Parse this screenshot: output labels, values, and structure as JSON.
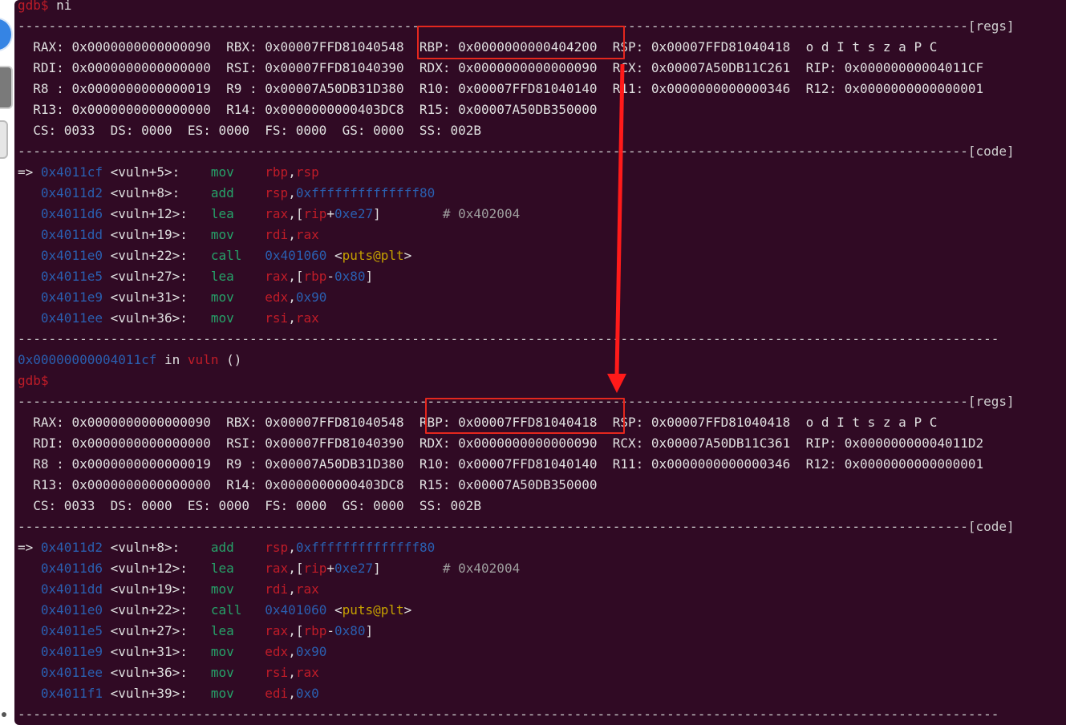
{
  "prompt": "gdb$",
  "first_command": "ni",
  "separator_regs": "---------------------------------------------------------------------------------------------------------------------------[regs]",
  "separator_code": "---------------------------------------------------------------------------------------------------------------------------[code]",
  "separator_plain": "-------------------------------------------------------------------------------------------------------------------------------",
  "flags": "o d I t s z a P C",
  "before": {
    "regs": {
      "row1": [
        {
          "name": "RAX:",
          "value": "0x0000000000000090"
        },
        {
          "name": "RBX:",
          "value": "0x00007FFD81040548"
        },
        {
          "name": "RBP:",
          "value": "0x0000000000404200"
        },
        {
          "name": "RSP:",
          "value": "0x00007FFD81040418"
        }
      ],
      "row2": [
        {
          "name": "RDI:",
          "value": "0x0000000000000000"
        },
        {
          "name": "RSI:",
          "value": "0x00007FFD81040390"
        },
        {
          "name": "RDX:",
          "value": "0x0000000000000090"
        },
        {
          "name": "RCX:",
          "value": "0x00007A50DB11C261"
        },
        {
          "name": "RIP:",
          "value": "0x00000000004011CF"
        }
      ],
      "row3": [
        {
          "name": "R8 :",
          "value": "0x0000000000000019"
        },
        {
          "name": "R9 :",
          "value": "0x00007A50DB31D380"
        },
        {
          "name": "R10:",
          "value": "0x00007FFD81040140"
        },
        {
          "name": "R11:",
          "value": "0x0000000000000346"
        },
        {
          "name": "R12:",
          "value": "0x0000000000000001"
        }
      ],
      "row4": [
        {
          "name": "R13:",
          "value": "0x0000000000000000"
        },
        {
          "name": "R14:",
          "value": "0x0000000000403DC8"
        },
        {
          "name": "R15:",
          "value": "0x00007A50DB350000"
        }
      ],
      "segs": "CS: 0033  DS: 0000  ES: 0000  FS: 0000  GS: 0000  SS: 002B"
    },
    "code": [
      {
        "cur": "=>",
        "addr": "0x4011cf",
        "sym": "<vuln+5>:",
        "mn": "mov",
        "ops": [
          [
            "rbp",
            "r"
          ],
          [
            ",",
            "w"
          ],
          [
            "rsp",
            "r"
          ]
        ]
      },
      {
        "cur": "  ",
        "addr": "0x4011d2",
        "sym": "<vuln+8>:",
        "mn": "add",
        "ops": [
          [
            "rsp",
            "r"
          ],
          [
            ",",
            "w"
          ],
          [
            "0xffffffffffffff80",
            "b"
          ]
        ]
      },
      {
        "cur": "  ",
        "addr": "0x4011d6",
        "sym": "<vuln+12>:",
        "mn": "lea",
        "ops": [
          [
            "rax",
            "r"
          ],
          [
            ",[",
            "w"
          ],
          [
            "rip",
            "r"
          ],
          [
            "+",
            "w"
          ],
          [
            "0xe27",
            "b"
          ],
          [
            "]",
            "w"
          ],
          [
            "        # 0x402004",
            "g"
          ]
        ]
      },
      {
        "cur": "  ",
        "addr": "0x4011dd",
        "sym": "<vuln+19>:",
        "mn": "mov",
        "ops": [
          [
            "rdi",
            "r"
          ],
          [
            ",",
            "w"
          ],
          [
            "rax",
            "r"
          ]
        ]
      },
      {
        "cur": "  ",
        "addr": "0x4011e0",
        "sym": "<vuln+22>:",
        "mn": "call",
        "ops": [
          [
            "0x401060",
            "b"
          ],
          [
            " <",
            "w"
          ],
          [
            "puts@plt",
            "y"
          ],
          [
            ">",
            "w"
          ]
        ]
      },
      {
        "cur": "  ",
        "addr": "0x4011e5",
        "sym": "<vuln+27>:",
        "mn": "lea",
        "ops": [
          [
            "rax",
            "r"
          ],
          [
            ",[",
            "w"
          ],
          [
            "rbp",
            "r"
          ],
          [
            "-",
            "w"
          ],
          [
            "0x80",
            "b"
          ],
          [
            "]",
            "w"
          ]
        ]
      },
      {
        "cur": "  ",
        "addr": "0x4011e9",
        "sym": "<vuln+31>:",
        "mn": "mov",
        "ops": [
          [
            "edx",
            "r"
          ],
          [
            ",",
            "w"
          ],
          [
            "0x90",
            "b"
          ]
        ]
      },
      {
        "cur": "  ",
        "addr": "0x4011ee",
        "sym": "<vuln+36>:",
        "mn": "mov",
        "ops": [
          [
            "rsi",
            "r"
          ],
          [
            ",",
            "w"
          ],
          [
            "rax",
            "r"
          ]
        ]
      }
    ],
    "location": {
      "addr": "0x00000000004011cf",
      "in": " in ",
      "func": "vuln",
      "rest": " ()"
    }
  },
  "after": {
    "regs": {
      "row1": [
        {
          "name": "RAX:",
          "value": "0x0000000000000090"
        },
        {
          "name": "RBX:",
          "value": "0x00007FFD81040548"
        },
        {
          "name": "RBP:",
          "value": "0x00007FFD81040418"
        },
        {
          "name": "RSP:",
          "value": "0x00007FFD81040418"
        }
      ],
      "row2": [
        {
          "name": "RDI:",
          "value": "0x0000000000000000"
        },
        {
          "name": "RSI:",
          "value": "0x00007FFD81040390"
        },
        {
          "name": "RDX:",
          "value": "0x0000000000000090"
        },
        {
          "name": "RCX:",
          "value": "0x00007A50DB11C361"
        },
        {
          "name": "RIP:",
          "value": "0x00000000004011D2"
        }
      ],
      "row3": [
        {
          "name": "R8 :",
          "value": "0x0000000000000019"
        },
        {
          "name": "R9 :",
          "value": "0x00007A50DB31D380"
        },
        {
          "name": "R10:",
          "value": "0x00007FFD81040140"
        },
        {
          "name": "R11:",
          "value": "0x0000000000000346"
        },
        {
          "name": "R12:",
          "value": "0x0000000000000001"
        }
      ],
      "row4": [
        {
          "name": "R13:",
          "value": "0x0000000000000000"
        },
        {
          "name": "R14:",
          "value": "0x0000000000403DC8"
        },
        {
          "name": "R15:",
          "value": "0x00007A50DB350000"
        }
      ],
      "segs": "CS: 0033  DS: 0000  ES: 0000  FS: 0000  GS: 0000  SS: 002B"
    },
    "code": [
      {
        "cur": "=>",
        "addr": "0x4011d2",
        "sym": "<vuln+8>:",
        "mn": "add",
        "ops": [
          [
            "rsp",
            "r"
          ],
          [
            ",",
            "w"
          ],
          [
            "0xffffffffffffff80",
            "b"
          ]
        ]
      },
      {
        "cur": "  ",
        "addr": "0x4011d6",
        "sym": "<vuln+12>:",
        "mn": "lea",
        "ops": [
          [
            "rax",
            "r"
          ],
          [
            ",[",
            "w"
          ],
          [
            "rip",
            "r"
          ],
          [
            "+",
            "w"
          ],
          [
            "0xe27",
            "b"
          ],
          [
            "]",
            "w"
          ],
          [
            "        # 0x402004",
            "g"
          ]
        ]
      },
      {
        "cur": "  ",
        "addr": "0x4011dd",
        "sym": "<vuln+19>:",
        "mn": "mov",
        "ops": [
          [
            "rdi",
            "r"
          ],
          [
            ",",
            "w"
          ],
          [
            "rax",
            "r"
          ]
        ]
      },
      {
        "cur": "  ",
        "addr": "0x4011e0",
        "sym": "<vuln+22>:",
        "mn": "call",
        "ops": [
          [
            "0x401060",
            "b"
          ],
          [
            " <",
            "w"
          ],
          [
            "puts@plt",
            "y"
          ],
          [
            ">",
            "w"
          ]
        ]
      },
      {
        "cur": "  ",
        "addr": "0x4011e5",
        "sym": "<vuln+27>:",
        "mn": "lea",
        "ops": [
          [
            "rax",
            "r"
          ],
          [
            ",[",
            "w"
          ],
          [
            "rbp",
            "r"
          ],
          [
            "-",
            "w"
          ],
          [
            "0x80",
            "b"
          ],
          [
            "]",
            "w"
          ]
        ]
      },
      {
        "cur": "  ",
        "addr": "0x4011e9",
        "sym": "<vuln+31>:",
        "mn": "mov",
        "ops": [
          [
            "edx",
            "r"
          ],
          [
            ",",
            "w"
          ],
          [
            "0x90",
            "b"
          ]
        ]
      },
      {
        "cur": "  ",
        "addr": "0x4011ee",
        "sym": "<vuln+36>:",
        "mn": "mov",
        "ops": [
          [
            "rsi",
            "r"
          ],
          [
            ",",
            "w"
          ],
          [
            "rax",
            "r"
          ]
        ]
      },
      {
        "cur": "  ",
        "addr": "0x4011f1",
        "sym": "<vuln+39>:",
        "mn": "mov",
        "ops": [
          [
            "edi",
            "r"
          ],
          [
            ",",
            "w"
          ],
          [
            "0x0",
            "b"
          ]
        ]
      }
    ]
  },
  "colors": {
    "terminal_bg": "#300a24",
    "highlight_box": "#e4271e",
    "arrow": "#ff1a1a"
  }
}
